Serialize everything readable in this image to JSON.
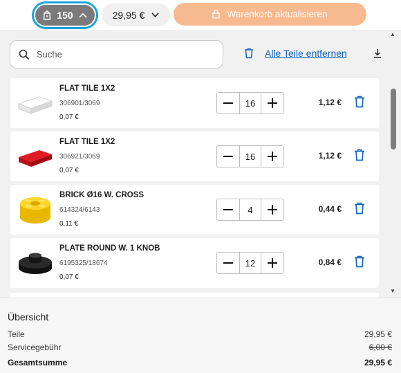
{
  "toolbar": {
    "count": "150",
    "price": "29,95 €",
    "update_label": "Warenkorb aktualisieren"
  },
  "search": {
    "placeholder": "Suche"
  },
  "actions": {
    "remove_all": "Alle Teile entfernen"
  },
  "items": [
    {
      "name": "FLAT TILE 1X2",
      "sku": "306901/3069",
      "unit_price": "0,07 €",
      "qty": "16",
      "total": "1,12 €",
      "color": "#ffffff",
      "shape": "tile"
    },
    {
      "name": "FLAT TILE 1X2",
      "sku": "306921/3069",
      "unit_price": "0,07 €",
      "qty": "16",
      "total": "1,12 €",
      "color": "#d8141c",
      "shape": "tile"
    },
    {
      "name": "BRICK Ø16 W. CROSS",
      "sku": "614324/6143",
      "unit_price": "0,11 €",
      "qty": "4",
      "total": "0,44 €",
      "color": "#f5cd2f",
      "shape": "round-brick"
    },
    {
      "name": "PLATE ROUND W. 1 KNOB",
      "sku": "6195325/18674",
      "unit_price": "0,07 €",
      "qty": "12",
      "total": "0,84 €",
      "color": "#1e1e1e",
      "shape": "round-plate"
    }
  ],
  "summary": {
    "title": "Übersicht",
    "parts_label": "Teile",
    "parts_value": "29,95 €",
    "fee_label": "Servicegebühr",
    "fee_value": "6,00 €",
    "total_label": "Gesamtsumme",
    "total_value": "29,95 €"
  },
  "colors": {
    "accent": "#1aa3d9",
    "update_button": "#f7b98f",
    "link": "#1565c0"
  }
}
